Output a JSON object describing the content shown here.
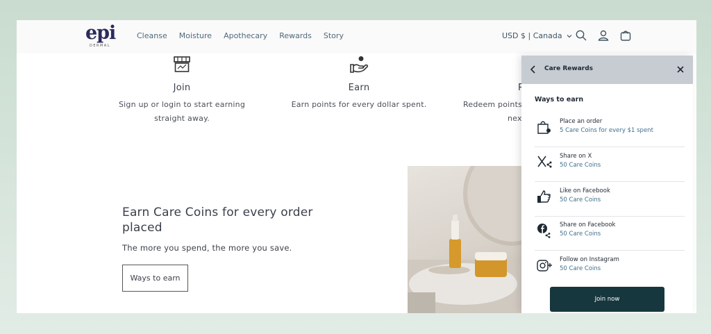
{
  "header": {
    "logo_text": "epi",
    "logo_subtext": "DERMAL",
    "nav": [
      "Cleanse",
      "Moisture",
      "Apothecary",
      "Rewards",
      "Story"
    ],
    "currency": "USD $ | Canada",
    "icons": [
      "search-icon",
      "account-icon",
      "cart-icon"
    ]
  },
  "features": [
    {
      "icon": "storefront-icon",
      "title": "Join",
      "text": "Sign up or login to start earning straight away."
    },
    {
      "icon": "hand-coin-icon",
      "title": "Earn",
      "text": "Earn points for every dollar spent."
    },
    {
      "icon": "redeem-icon",
      "title": "R",
      "text": "Redeem points",
      "text2": "nex"
    }
  ],
  "promo": {
    "title": "Earn Care Coins for every order placed",
    "subtitle": "The more you spend, the more you save.",
    "button": "Ways to earn"
  },
  "panel": {
    "title": "Care Rewards",
    "section_title": "Ways to earn",
    "items": [
      {
        "name": "Place an order",
        "points": "5 Care Coins for every $1 spent",
        "icon": "shopping-bag-icon"
      },
      {
        "name": "Share on X",
        "points": "50 Care Coins",
        "icon": "x-share-icon"
      },
      {
        "name": "Like on Facebook",
        "points": "50 Care Coins",
        "icon": "thumbs-up-icon"
      },
      {
        "name": "Share on Facebook",
        "points": "50 Care Coins",
        "icon": "facebook-share-icon"
      },
      {
        "name": "Follow on Instagram",
        "points": "50 Care Coins",
        "icon": "instagram-follow-icon"
      }
    ],
    "join_button": "Join now"
  },
  "colors": {
    "accent": "#17373f",
    "link": "#3f6f8e",
    "logo": "#2b2b5c"
  }
}
